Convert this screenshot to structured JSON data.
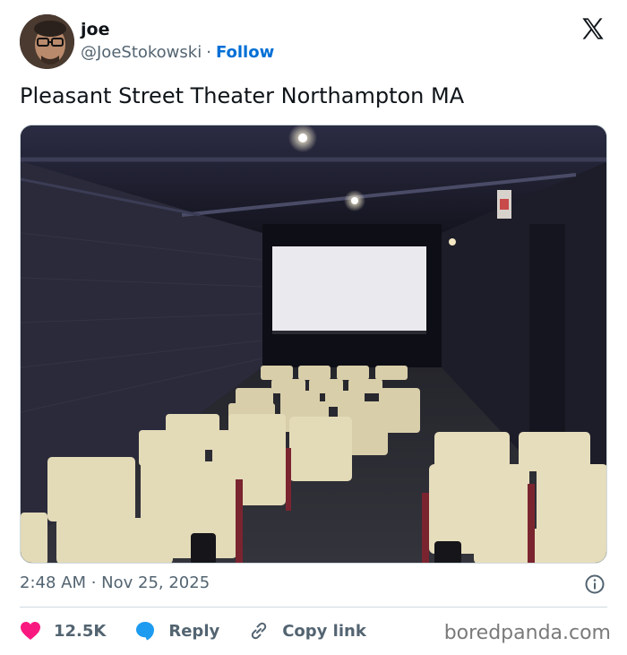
{
  "author": {
    "name": "joe",
    "handle": "@JoeStokowski",
    "separator": "·",
    "follow_label": "Follow"
  },
  "tweet": {
    "text": "Pleasant Street Theater Northampton MA",
    "timestamp": "2:48 AM · Nov 25, 2025"
  },
  "actions": {
    "likes": "12.5K",
    "reply_label": "Reply",
    "copy_link_label": "Copy link"
  },
  "watermark": "boredpanda.com",
  "colors": {
    "like": "#f91880",
    "reply": "#1d9bf0",
    "follow": "#006fd6",
    "muted": "#536471"
  },
  "icons": [
    "x-logo-icon",
    "heart-icon",
    "reply-bubble-icon",
    "link-icon",
    "info-icon"
  ]
}
